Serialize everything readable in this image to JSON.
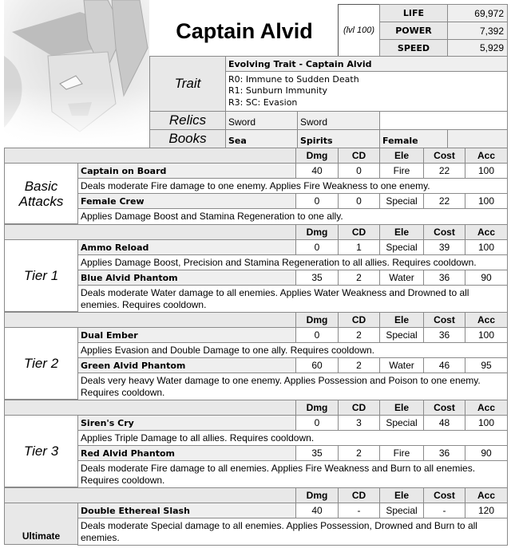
{
  "character": {
    "name": "Captain Alvid",
    "level": "(lvl 100)",
    "portrait": "captain-alvid-portrait",
    "stats": [
      {
        "label": "LIFE",
        "value": "69,972"
      },
      {
        "label": "POWER",
        "value": "7,392"
      },
      {
        "label": "SPEED",
        "value": "5,929"
      }
    ]
  },
  "trait": {
    "label": "Trait",
    "title": "Evolving Trait - Captain Alvid",
    "lines": [
      "R0: Immune to Sudden Death",
      "R1: Sunburn Immunity",
      "R3: SC: Evasion"
    ]
  },
  "relics": {
    "label": "Relics",
    "items": [
      "Sword",
      "Sword",
      ""
    ]
  },
  "books": {
    "label": "Books",
    "items": [
      "Sea",
      "Spirits",
      "Female",
      ""
    ]
  },
  "columns": [
    "Dmg",
    "CD",
    "Ele",
    "Cost",
    "Acc"
  ],
  "sections": [
    {
      "label": "Basic Attacks",
      "label_lines": [
        "Basic",
        "Attacks"
      ],
      "moves": [
        {
          "name": "Captain on Board",
          "dmg": "40",
          "cd": "0",
          "ele": "Fire",
          "cost": "22",
          "acc": "100",
          "desc": "Deals moderate Fire damage to one enemy. Applies Fire Weakness to one enemy."
        },
        {
          "name": "Female Crew",
          "dmg": "0",
          "cd": "0",
          "ele": "Special",
          "cost": "22",
          "acc": "100",
          "desc": "Applies Damage Boost and Stamina Regeneration to one ally."
        }
      ]
    },
    {
      "label": "Tier 1",
      "moves": [
        {
          "name": "Ammo Reload",
          "dmg": "0",
          "cd": "1",
          "ele": "Special",
          "cost": "39",
          "acc": "100",
          "desc": "Applies Damage Boost, Precision and Stamina Regeneration to all allies. Requires cooldown."
        },
        {
          "name": "Blue Alvid Phantom",
          "dmg": "35",
          "cd": "2",
          "ele": "Water",
          "cost": "36",
          "acc": "90",
          "desc": "Deals moderate Water damage to all enemies. Applies Water Weakness and Drowned to all enemies. Requires cooldown."
        }
      ]
    },
    {
      "label": "Tier 2",
      "moves": [
        {
          "name": "Dual Ember",
          "dmg": "0",
          "cd": "2",
          "ele": "Special",
          "cost": "36",
          "acc": "100",
          "desc": "Applies Evasion and Double Damage to one ally. Requires cooldown."
        },
        {
          "name": "Green Alvid Phantom",
          "dmg": "60",
          "cd": "2",
          "ele": "Water",
          "cost": "46",
          "acc": "95",
          "desc": "Deals very heavy Water damage to one enemy. Applies Possession and Poison to one enemy. Requires cooldown."
        }
      ]
    },
    {
      "label": "Tier 3",
      "moves": [
        {
          "name": "Siren's Cry",
          "dmg": "0",
          "cd": "3",
          "ele": "Special",
          "cost": "48",
          "acc": "100",
          "desc": "Applies Triple Damage to all allies. Requires cooldown."
        },
        {
          "name": "Red Alvid Phantom",
          "dmg": "35",
          "cd": "2",
          "ele": "Fire",
          "cost": "36",
          "acc": "90",
          "desc": "Deals moderate Fire damage to all enemies. Applies Fire Weakness and Burn to all enemies. Requires cooldown."
        }
      ]
    },
    {
      "label": "Ultimate",
      "moves": [
        {
          "name": "Double Ethereal Slash",
          "dmg": "40",
          "cd": "-",
          "ele": "Special",
          "cost": "-",
          "acc": "120",
          "desc": "Deals moderate Special damage to all enemies. Applies Possession, Drowned and Burn to all enemies."
        }
      ]
    }
  ]
}
